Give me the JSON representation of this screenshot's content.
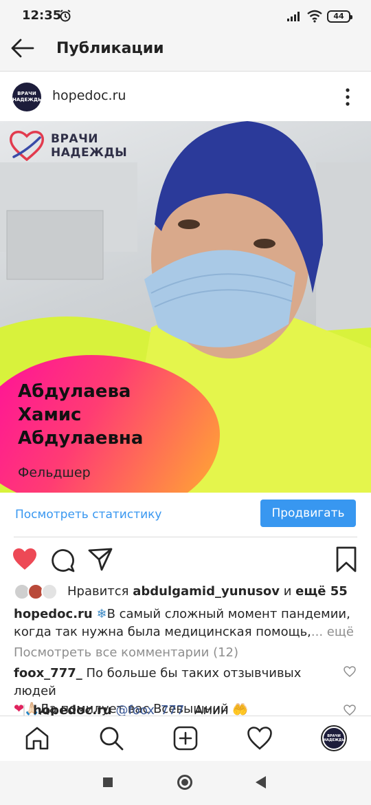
{
  "status_bar": {
    "time": "12:35",
    "battery": "44"
  },
  "header": {
    "title": "Публикации"
  },
  "post": {
    "username": "hopedoc.ru",
    "avatar_text": "ВРАЧИ НАДЕЖДЫ",
    "image": {
      "logo_line1": "ВРАЧИ",
      "logo_line2": "НАДЕЖДЫ",
      "name_line1": "Абдулаева",
      "name_line2": "Хамис",
      "name_line3": "Абдулаевна",
      "role": "Фельдшер"
    },
    "insights_link": "Посмотреть статистику",
    "promote_button": "Продвигать",
    "likes": {
      "prefix": "Нравится ",
      "user": "abdulgamid_yunusov",
      "middle": " и ",
      "others": "ещё 55"
    },
    "caption": {
      "user": "hopedoc.ru",
      "emoji": "❄",
      "text": "В самый сложный момент пандемии, когда так нужна была медицинская помощь,",
      "more": "... ещё"
    },
    "view_comments": "Посмотреть все комментарии (12)",
    "comments": [
      {
        "user": "foox_777_",
        "text": " По больше бы таких отзывчивых людей",
        "line2_emoji": "❤🙏🏻",
        "line2": "Да помилует вас Всевышний 🤲🏻"
      },
      {
        "user": "hopedoc.ru",
        "mention": "@foox_777_",
        "text": " Амин 🤲"
      }
    ]
  },
  "colors": {
    "accent": "#3897f0",
    "like_red": "#ed4956",
    "text": "#262626",
    "muted": "#8e8e8e"
  }
}
